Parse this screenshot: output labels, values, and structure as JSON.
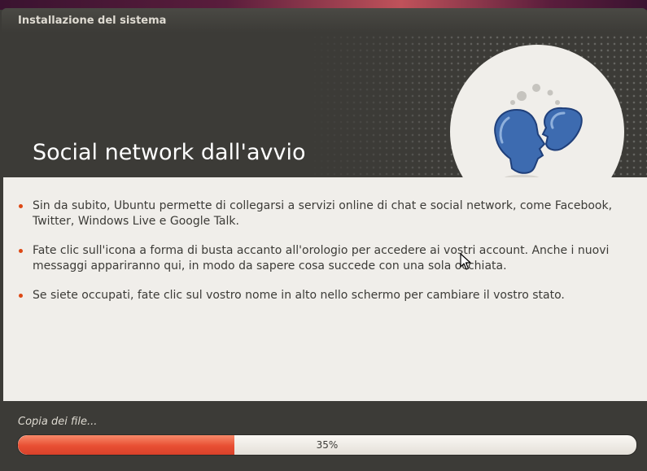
{
  "window": {
    "title": "Installazione del sistema"
  },
  "slide": {
    "title": "Social network dall'avvio",
    "icon": "social-heads-icon",
    "bullets": [
      "Sin da subito, Ubuntu permette di collegarsi a servizi online di chat e social network, come Facebook, Twitter, Windows Live e Google Talk.",
      "Fate clic sull'icona a forma di busta accanto all'orologio per accedere ai vostri account. Anche i nuovi messaggi appariranno qui, in modo da sapere cosa succede con una sola occhiata.",
      "Se siete occupati, fate clic sul vostro nome in alto nello schermo per cambiare il vostro stato."
    ]
  },
  "footer": {
    "status": "Copia dei file...",
    "progress_value": 0.35,
    "progress_label": "35%"
  },
  "colors": {
    "accent": "#dd4814",
    "window_bg": "#3c3b37",
    "content_bg": "#f0eeea",
    "icon_blue": "#3d6bb0"
  }
}
